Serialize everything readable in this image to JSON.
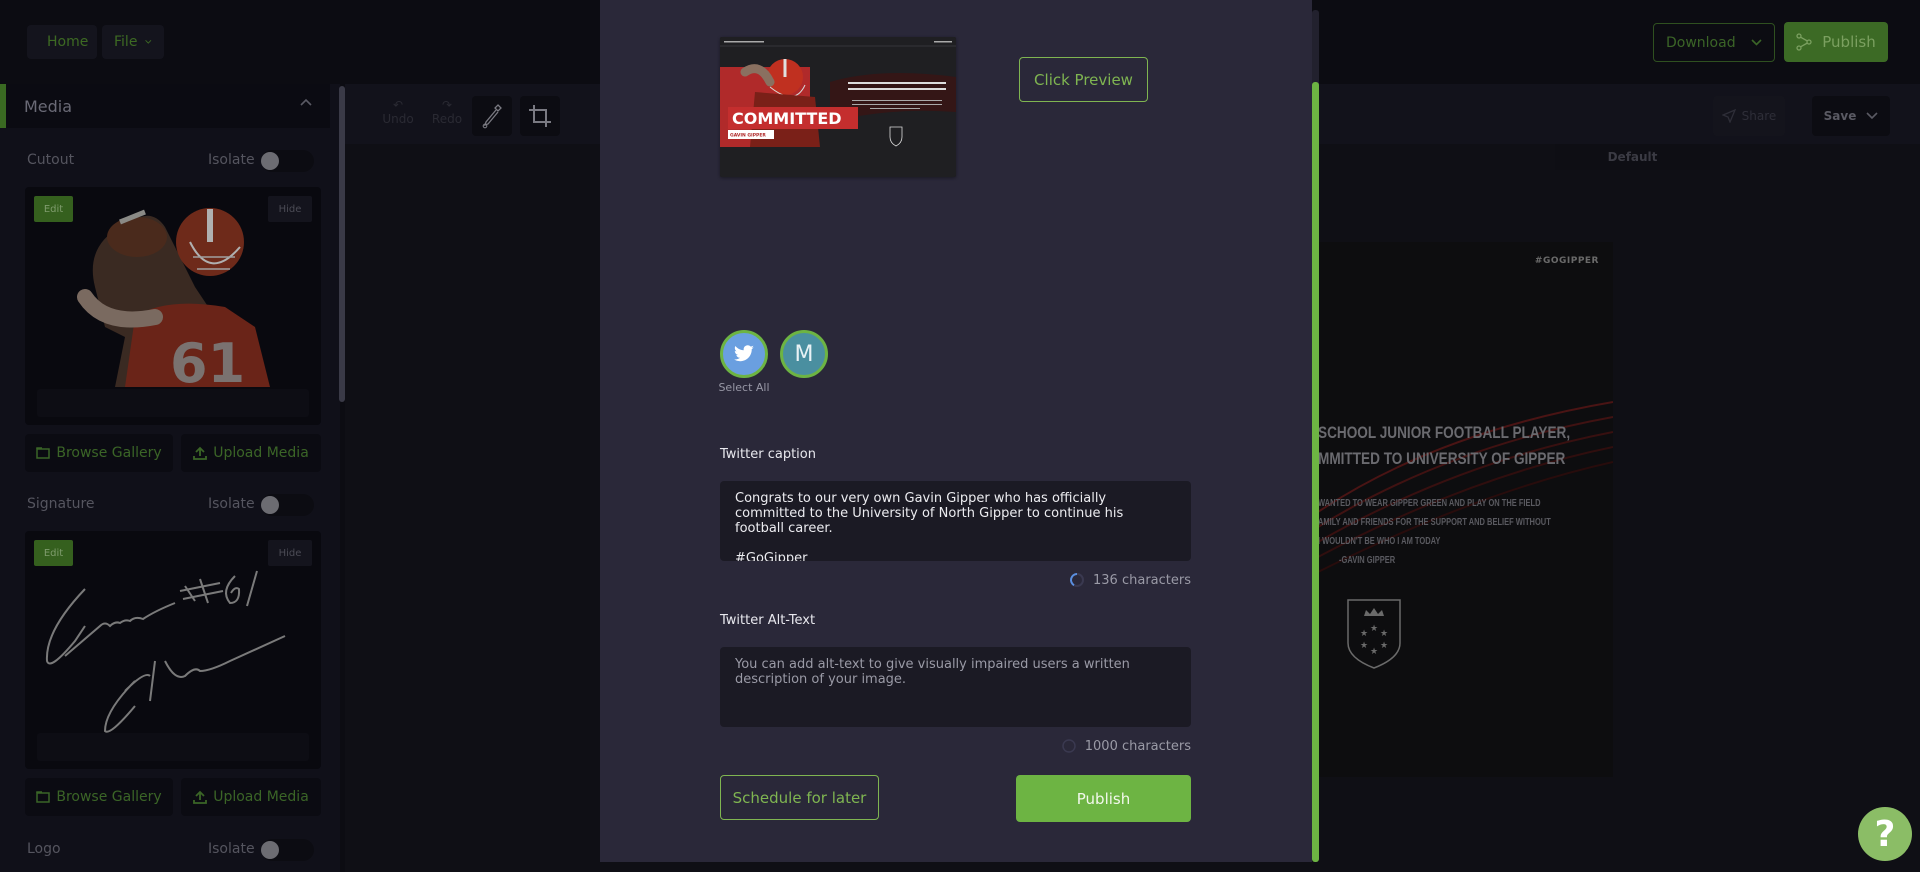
{
  "topbar": {
    "home_label": "Home",
    "file_label": "File",
    "download_label": "Download",
    "publish_label": "Publish"
  },
  "sidebar": {
    "section_title": "Media",
    "isolate_label": "Isolate",
    "edit_label": "Edit",
    "hide_label": "Hide",
    "browse_gallery_label": "Browse Gallery",
    "upload_media_label": "Upload Media",
    "items": [
      {
        "label": "Cutout",
        "isolate": false
      },
      {
        "label": "Signature",
        "isolate": false
      },
      {
        "label": "Logo",
        "isolate": false
      }
    ],
    "signature_text": "Gavin #61 Gipper"
  },
  "toolbar": {
    "undo_label": "Undo",
    "redo_label": "Redo",
    "share_label": "Share",
    "save_label": "Save",
    "default_tab": "Default"
  },
  "poster": {
    "hashtag": "#GOGIPPER",
    "headline_lines": [
      "SCHOOL JUNIOR FOOTBALL PLAYER,",
      "MMITTED TO UNIVERSITY OF GIPPER"
    ],
    "quote_lines": [
      "WANTED TO WEAR GIPPER GREEN AND PLAY ON THE FIELD",
      "AMILY AND FRIENDS FOR THE SUPPORT AND BELIEF WITHOUT",
      "I WOULDN'T BE WHO I AM TODAY",
      "-GAVIN GIPPER"
    ]
  },
  "modal": {
    "preview_thumb": {
      "title": "COMMITTED",
      "name": "GAVIN GIPPER",
      "headline": "WEST GIPPER HIGH SCHOOL JUNIOR FOOTBALL PLAYER, GAVIN GIPPER HAS COMMITTED TO UNIVERSITY OF GIPPER"
    },
    "click_preview_label": "Click Preview",
    "accounts": [
      {
        "name": "twitter",
        "icon": "twitter-bird-icon",
        "selected": true
      },
      {
        "name": "M",
        "initial": "M",
        "selected": true
      }
    ],
    "select_all_label": "Select All",
    "caption_label": "Twitter caption",
    "caption_value": "Congrats to our very own Gavin Gipper who has officially committed to the University of North Gipper to continue his football career.\n\n#GoGipper",
    "caption_counter": "136 characters",
    "alt_label": "Twitter Alt-Text",
    "alt_value": "",
    "alt_placeholder": "You can add alt-text to give visually impaired users a written description of your image.",
    "alt_counter": "1000 characters",
    "schedule_label": "Schedule for later",
    "publish_label": "Publish"
  },
  "help_label": "?",
  "colors": {
    "accent": "#6db443",
    "modal_bg": "#2a2839",
    "input_bg": "#1b1a24"
  }
}
